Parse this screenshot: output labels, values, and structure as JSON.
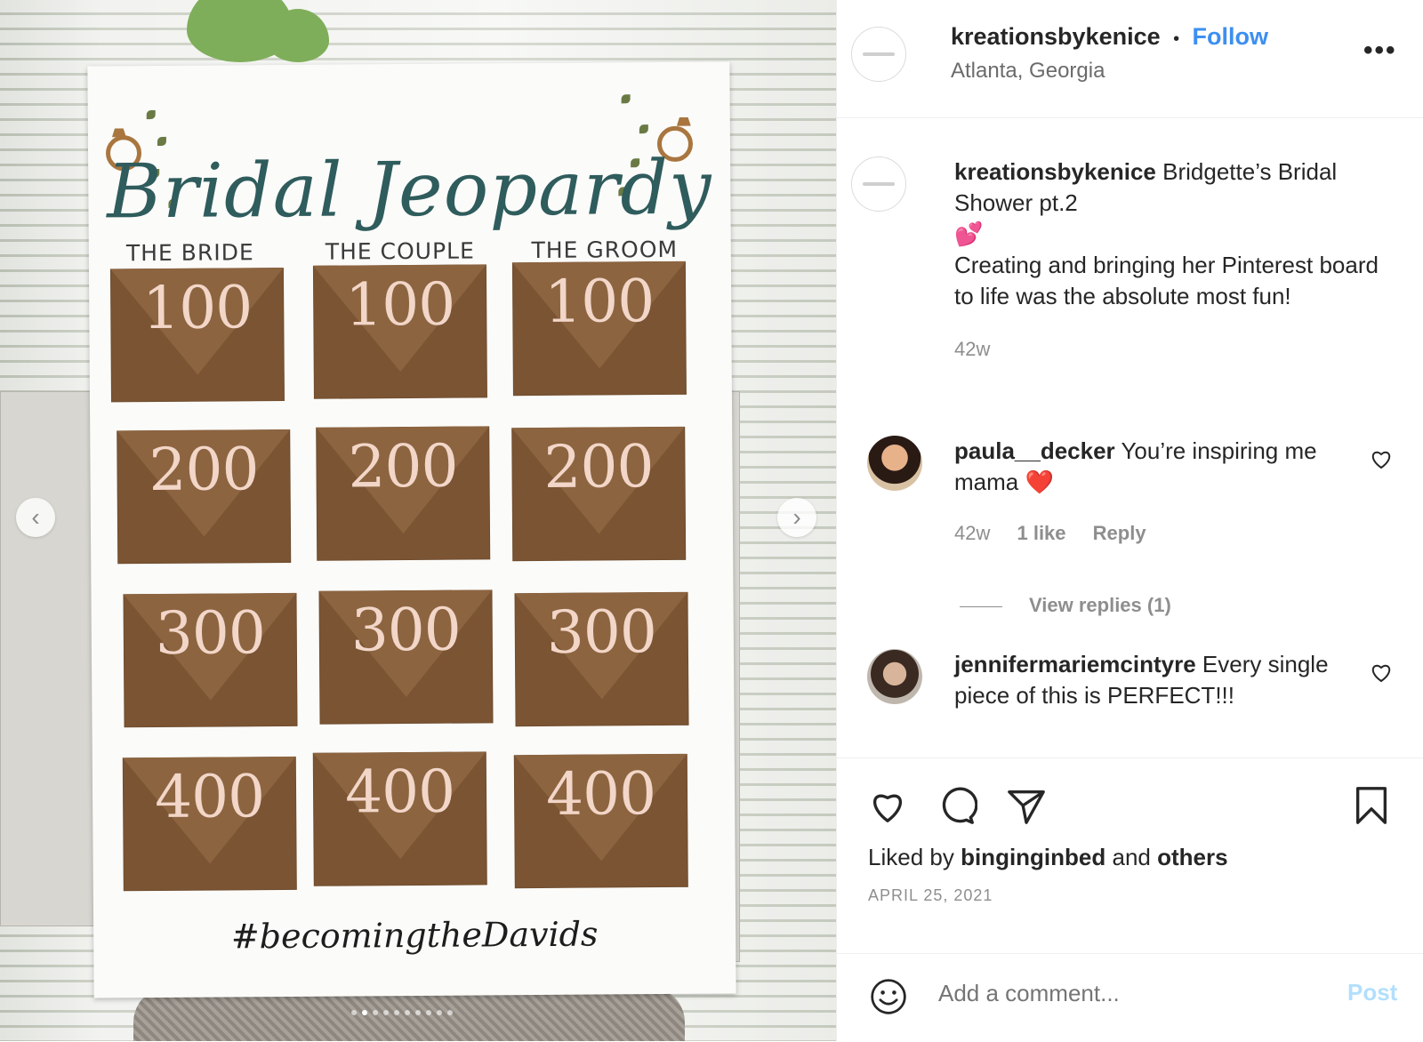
{
  "post": {
    "board": {
      "title": "Bridal Jeopardy",
      "columns": [
        "THE BRIDE",
        "THE COUPLE",
        "THE GROOM"
      ],
      "values": [
        "100",
        "200",
        "300",
        "400"
      ],
      "hashtag": "#becomingtheDavids"
    }
  },
  "header": {
    "username": "kreationsbykenice",
    "separator": "•",
    "follow_label": "Follow",
    "location": "Atlanta, Georgia",
    "more_label": "•••"
  },
  "caption": {
    "username": "kreationsbykenice",
    "text_1": "Bridgette’s Bridal Shower pt.2",
    "emoji": "💕",
    "text_2": "Creating and bringing her Pinterest board to life was the absolute most fun!",
    "time": "42w"
  },
  "comments": [
    {
      "username": "paula__decker",
      "text": "You’re inspiring me mama",
      "emoji": "❤️",
      "time": "42w",
      "likes": "1 like",
      "reply": "Reply",
      "view_replies": "View replies (1)"
    },
    {
      "username": "jennifermariemcintyre",
      "text": "Every single piece of this is PERFECT!!!"
    }
  ],
  "likes": {
    "prefix": "Liked by",
    "user": "binginginbed",
    "middle": "and",
    "others": "others"
  },
  "date": "APRIL 25, 2021",
  "add_comment": {
    "placeholder": "Add a comment...",
    "post_label": "Post"
  },
  "colors": {
    "accent": "#3d8ff0",
    "post_disabled": "#b2dffc",
    "envelope": "#7a5433",
    "title_teal": "#2f5c5c"
  }
}
